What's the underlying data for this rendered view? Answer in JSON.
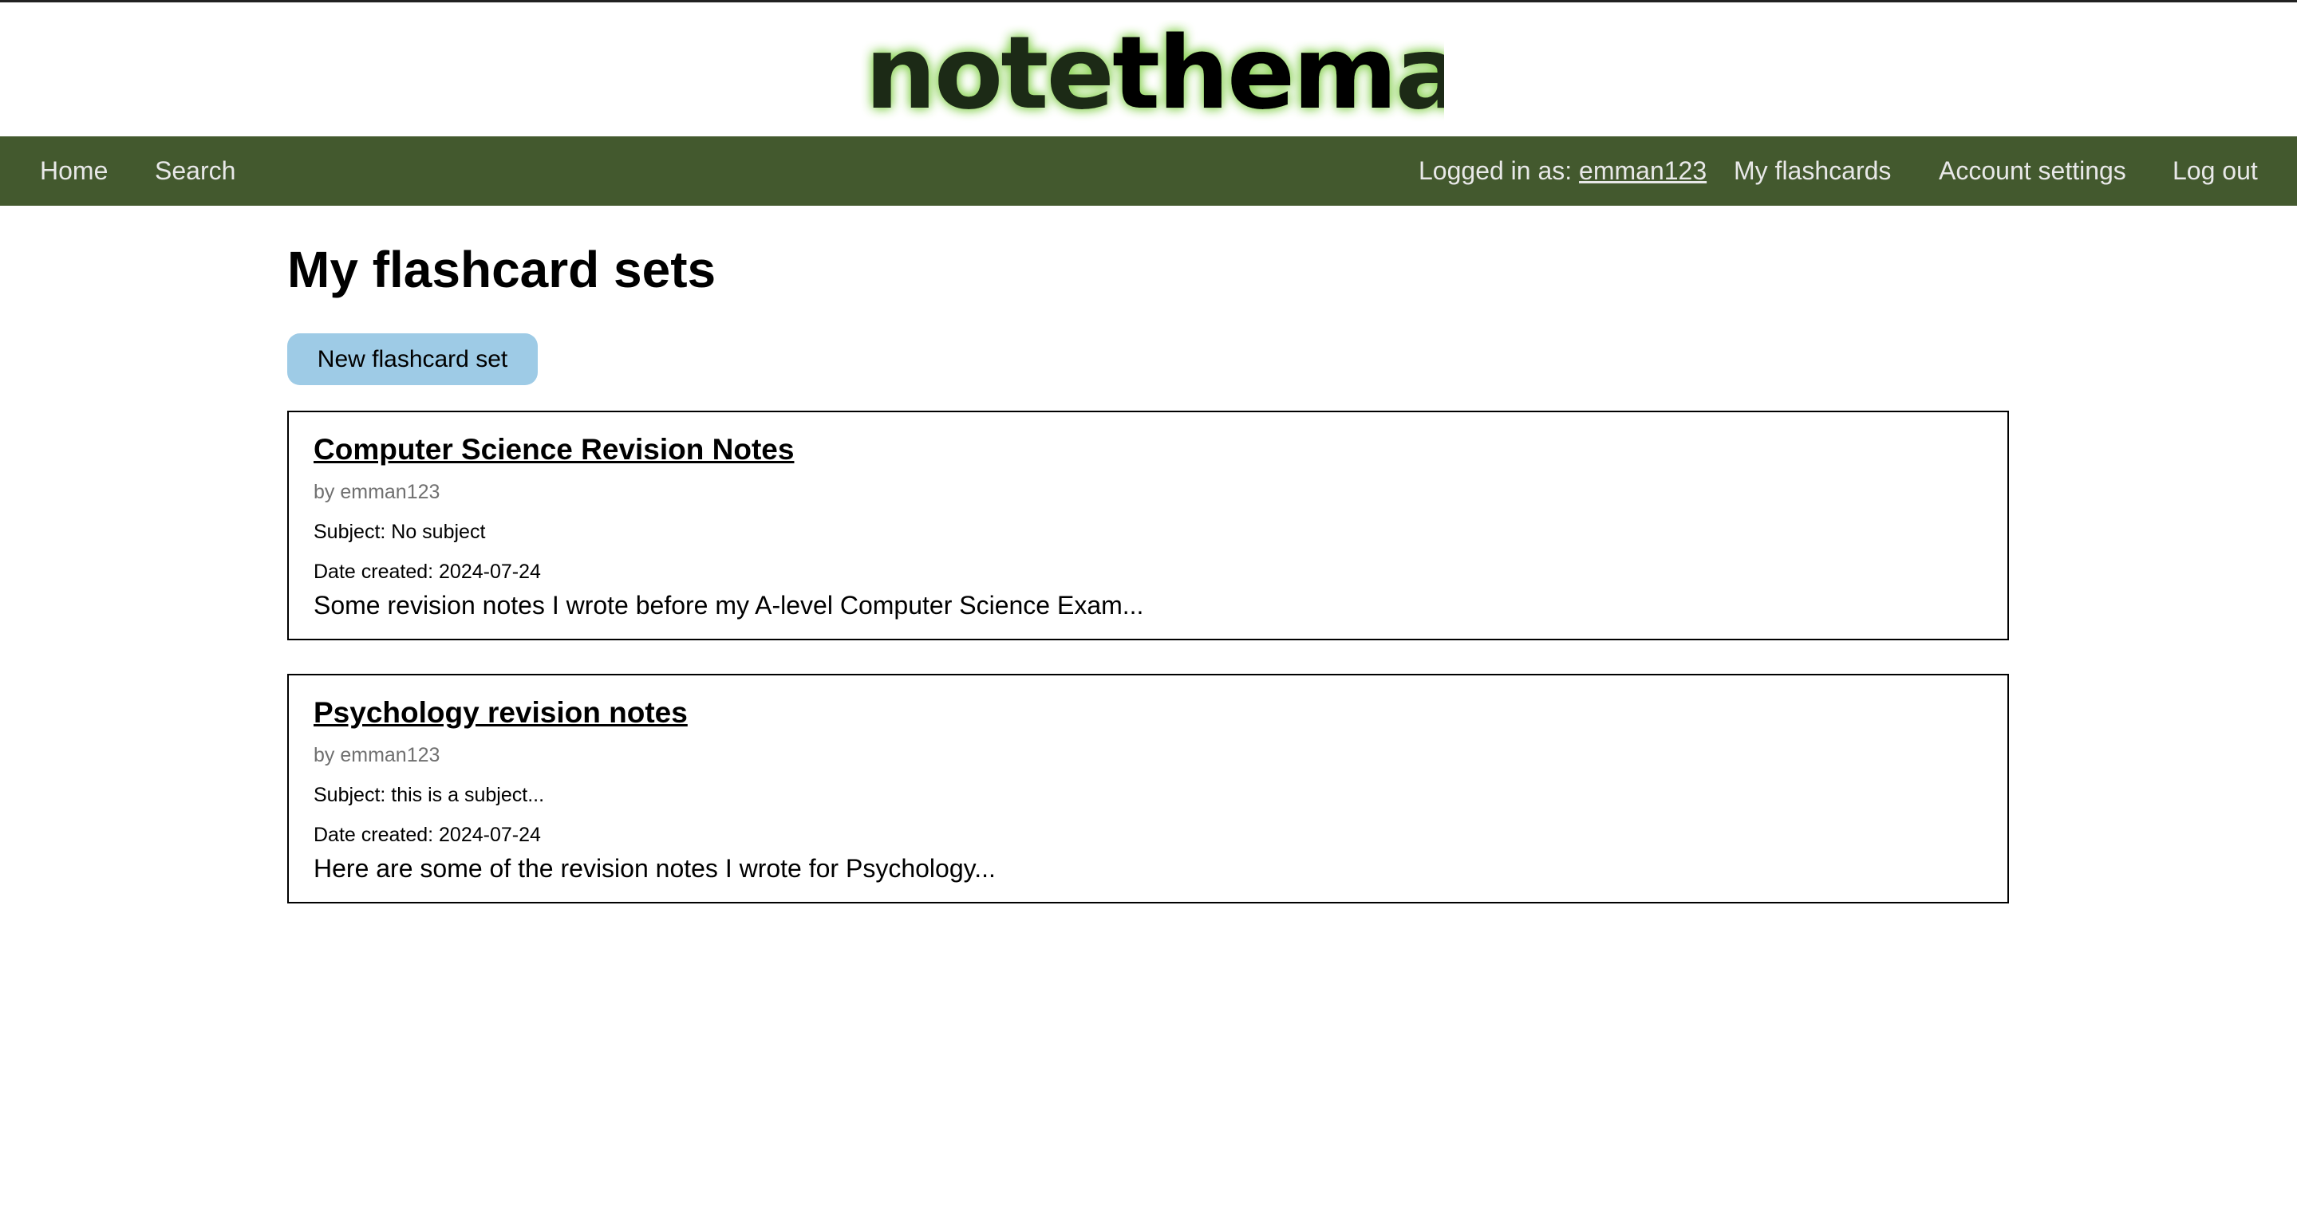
{
  "logo": {
    "part1": "note",
    "part2": "them",
    "part3": "all"
  },
  "nav": {
    "home": "Home",
    "search": "Search",
    "logged_in_prefix": "Logged in as: ",
    "username": "emman123",
    "my_flashcards": "My flashcards",
    "account_settings": "Account settings",
    "log_out": "Log out"
  },
  "main": {
    "title": "My flashcard sets",
    "new_button": "New flashcard set",
    "sets": [
      {
        "title": "Computer Science Revision Notes",
        "author": "by emman123",
        "subject": "Subject: No subject",
        "date": "Date created: 2024-07-24",
        "description": "Some revision notes I wrote before my A-level Computer Science Exam..."
      },
      {
        "title": "Psychology revision notes",
        "author": "by emman123",
        "subject": "Subject: this is a subject...",
        "date": "Date created: 2024-07-24",
        "description": "Here are some of the revision notes I wrote for Psychology..."
      }
    ]
  },
  "colors": {
    "navbar": "#43592e",
    "button": "#9ecbe6",
    "logo_dark": "#1f2a12",
    "logo_black": "#000000",
    "logo_glow": "#8fd45c"
  }
}
